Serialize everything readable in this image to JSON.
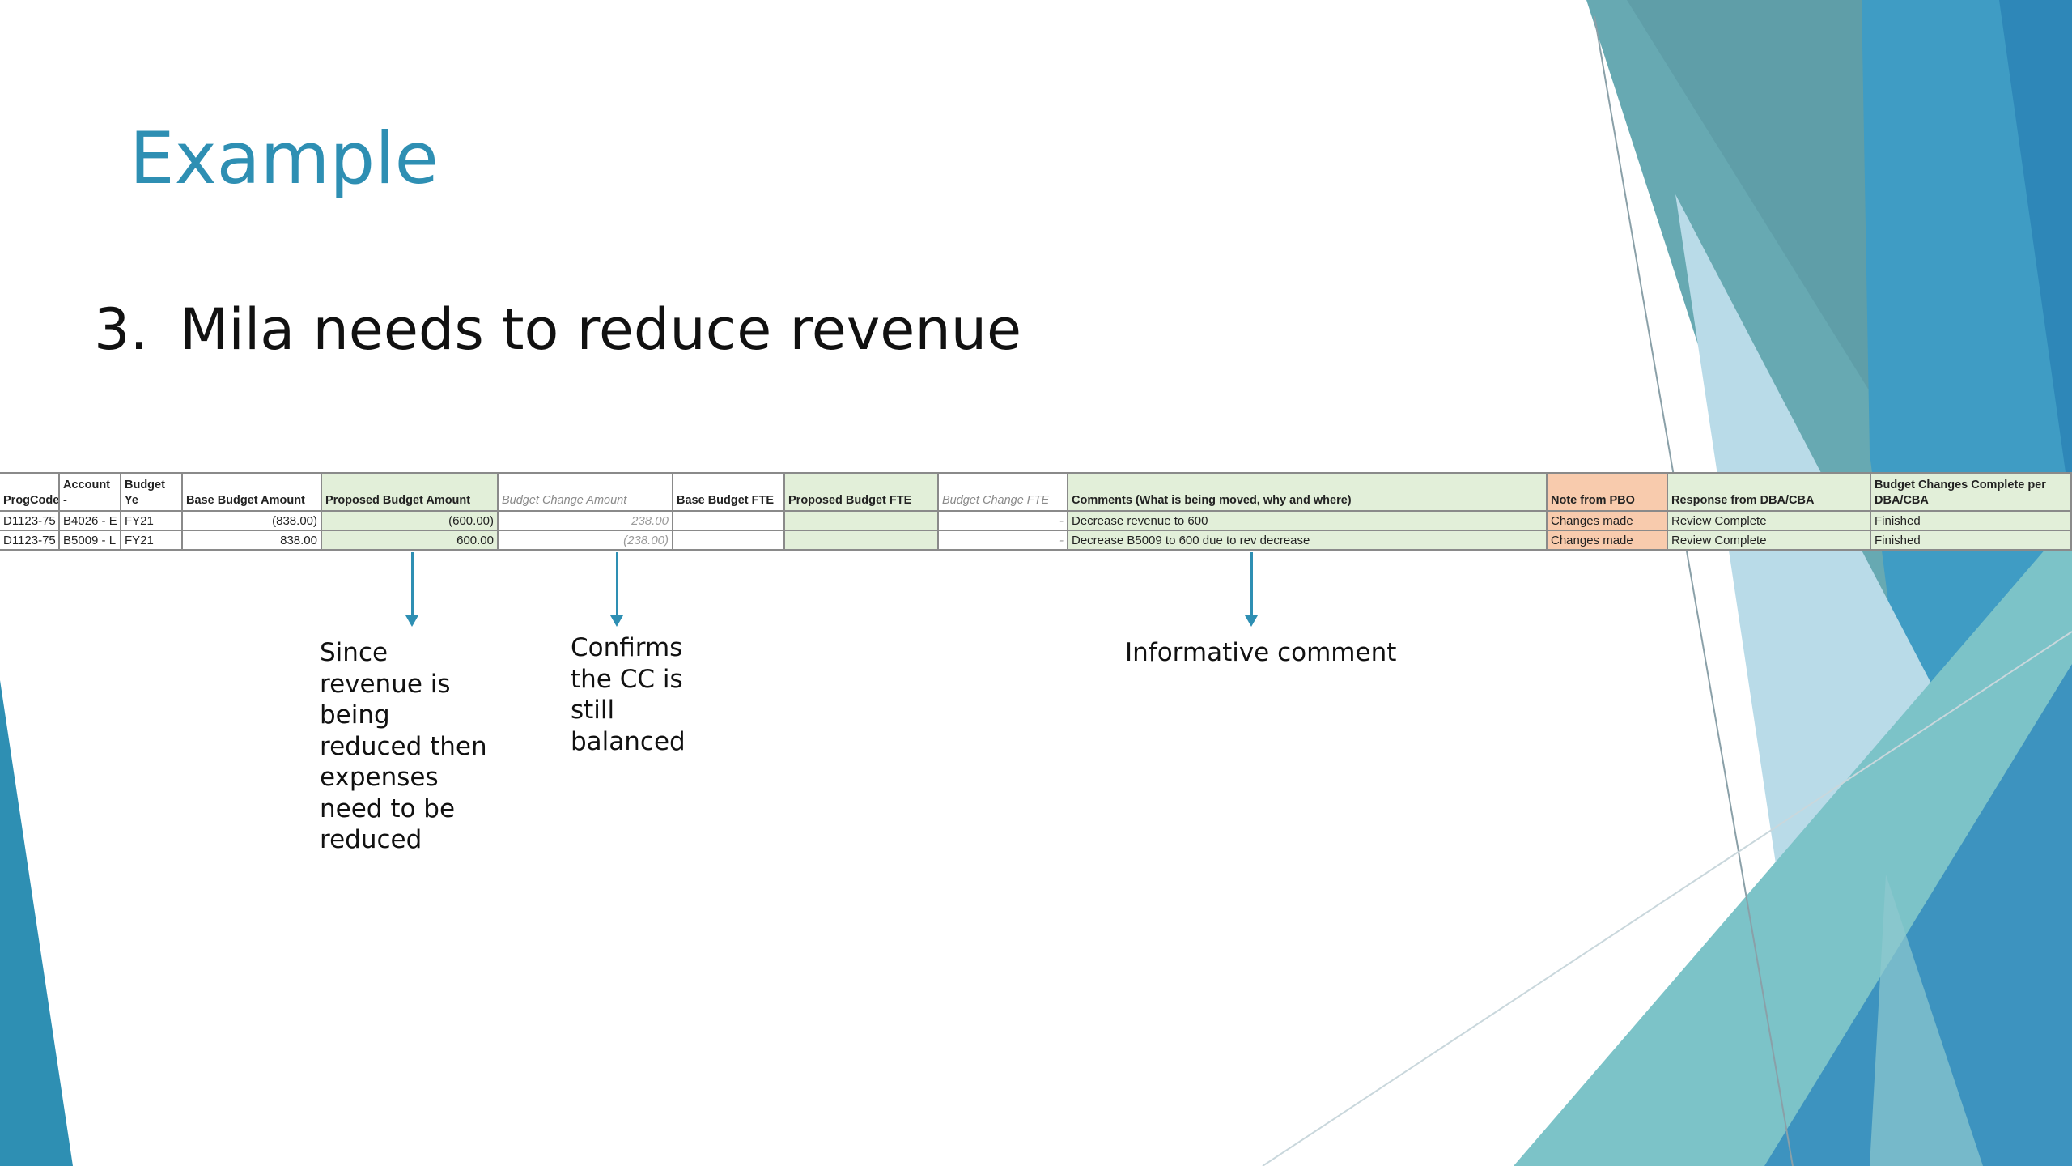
{
  "slide": {
    "title": "Example",
    "bullet_number": "3.",
    "bullet_text": "Mila needs to reduce revenue"
  },
  "table": {
    "headers": [
      "ProgCode",
      "Account - ",
      "Budget Ye",
      "Base Budget Amount",
      "Proposed Budget Amount",
      "Budget Change Amount",
      "Base Budget FTE",
      "Proposed Budget FTE",
      "Budget Change FTE",
      "Comments (What is being moved, why and where)",
      "Note from PBO",
      "Response from DBA/CBA",
      "Budget Changes Complete per DBA/CBA"
    ],
    "rows": [
      [
        "D1123-75",
        "B4026 - E",
        "FY21",
        "(838.00)",
        "(600.00)",
        "238.00",
        "",
        "",
        "-",
        "Decrease revenue to 600",
        "Changes made",
        "Review Complete",
        "Finished"
      ],
      [
        "D1123-75",
        "B5009 - L",
        "FY21",
        "838.00",
        "600.00",
        "(238.00)",
        "",
        "",
        "-",
        "Decrease B5009 to 600 due to rev decrease",
        "Changes made",
        "Review Complete",
        "Finished"
      ]
    ]
  },
  "callouts": {
    "revenue_note": [
      "Since",
      "revenue is",
      "being",
      "reduced then",
      "expenses",
      "need to be",
      "reduced"
    ],
    "balance_note": [
      "Confirms",
      "the CC is",
      "still",
      "balanced"
    ],
    "comment_note": "Informative comment"
  },
  "colors": {
    "accent": "#2e8fb3",
    "proposed_fill": "#e2efd9",
    "pbo_fill": "#f8cbad"
  }
}
